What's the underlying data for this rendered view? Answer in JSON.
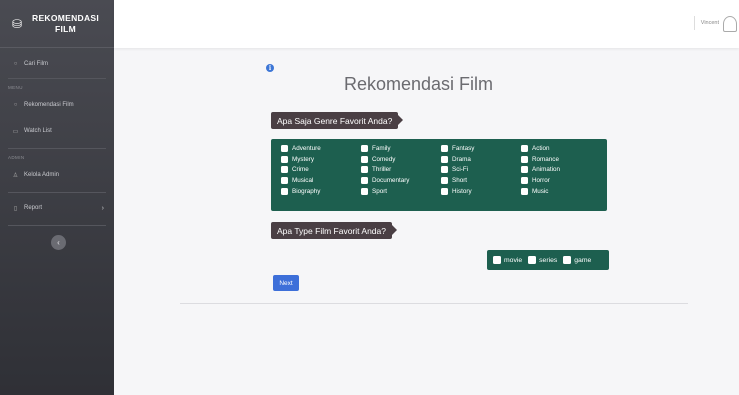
{
  "app": {
    "title_line1": "REKOMENDASI",
    "title_line2": "FILM"
  },
  "sidebar": {
    "items": [
      {
        "label": "Cari Film",
        "icon": "search-icon"
      },
      {
        "section": "MENU"
      },
      {
        "label": "Rekomendasi Film",
        "icon": "film-icon"
      },
      {
        "label": "Watch List",
        "icon": "list-icon"
      },
      {
        "section": "ADMIN"
      },
      {
        "label": "Kelola Admin",
        "icon": "user-icon"
      },
      {
        "label": "Report",
        "icon": "report-icon"
      }
    ],
    "collapse_glyph": "‹"
  },
  "topbar": {
    "user_name": "Vincent"
  },
  "main": {
    "title": "Rekomendasi Film",
    "genre_question": "Apa Saja Genre Favorit Anda?",
    "genres": [
      [
        "Adventure",
        "Family",
        "Fantasy",
        "Action"
      ],
      [
        "Mystery",
        "Comedy",
        "Drama",
        "Romance"
      ],
      [
        "Crime",
        "Thriller",
        "Sci-Fi",
        "Animation"
      ],
      [
        "Musical",
        "Documentary",
        "Short",
        "Horror"
      ],
      [
        "Biography",
        "Sport",
        "History",
        "Music"
      ]
    ],
    "type_question": "Apa Type Film Favorit Anda?",
    "types": [
      "movie",
      "series",
      "game"
    ],
    "next_label": "Next"
  },
  "colors": {
    "accent": "#3d6fd9",
    "panel": "#1d5f4f",
    "label_bg": "#4a3f44",
    "sidebar": "#3b3c42"
  }
}
